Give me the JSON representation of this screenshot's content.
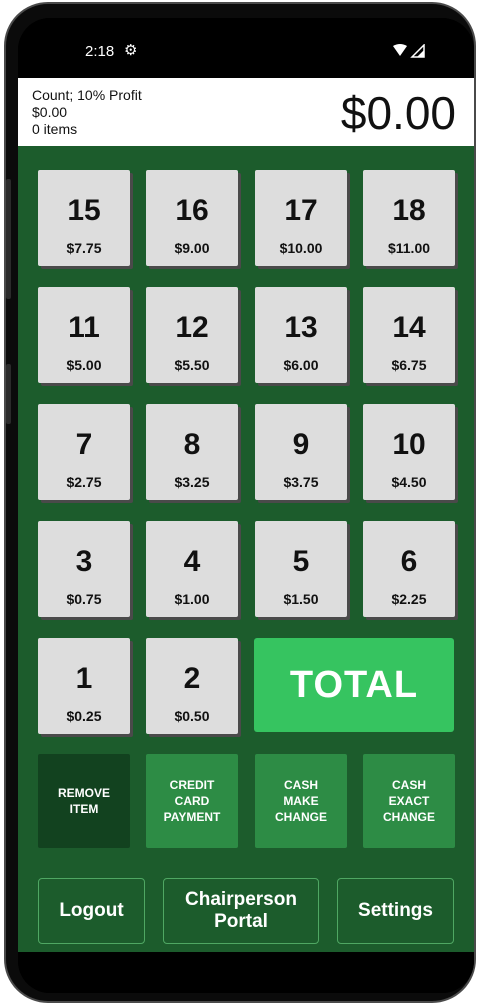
{
  "status_bar": {
    "time": "2:18",
    "settings_glyph": "gear-icon",
    "wifi_icon": "wifi-icon",
    "signal_icon": "signal-icon"
  },
  "header": {
    "line1": "Count; 10% Profit",
    "line2": "$0.00",
    "line3": "0 items",
    "total": "$0.00"
  },
  "tiles": [
    {
      "num": "15",
      "price": "$7.75"
    },
    {
      "num": "16",
      "price": "$9.00"
    },
    {
      "num": "17",
      "price": "$10.00"
    },
    {
      "num": "18",
      "price": "$11.00"
    },
    {
      "num": "11",
      "price": "$5.00"
    },
    {
      "num": "12",
      "price": "$5.50"
    },
    {
      "num": "13",
      "price": "$6.00"
    },
    {
      "num": "14",
      "price": "$6.75"
    },
    {
      "num": "7",
      "price": "$2.75"
    },
    {
      "num": "8",
      "price": "$3.25"
    },
    {
      "num": "9",
      "price": "$3.75"
    },
    {
      "num": "10",
      "price": "$4.50"
    },
    {
      "num": "3",
      "price": "$0.75"
    },
    {
      "num": "4",
      "price": "$1.00"
    },
    {
      "num": "5",
      "price": "$1.50"
    },
    {
      "num": "6",
      "price": "$2.25"
    },
    {
      "num": "1",
      "price": "$0.25"
    },
    {
      "num": "2",
      "price": "$0.50"
    }
  ],
  "total_button": "TOTAL",
  "actions": {
    "remove": [
      "REMOVE",
      "ITEM"
    ],
    "credit": [
      "CREDIT",
      "CARD",
      "PAYMENT"
    ],
    "make_change": [
      "CASH",
      "MAKE",
      "CHANGE"
    ],
    "exact_change": [
      "CASH",
      "EXACT",
      "CHANGE"
    ]
  },
  "bottom": {
    "logout": "Logout",
    "chair": [
      "Chairperson",
      "Portal"
    ],
    "settings": "Settings"
  },
  "colors": {
    "background_green": "#1c5c2c",
    "tile_gray": "#dddddd",
    "total_green": "#36c460",
    "action_green": "#2d8c45",
    "remove_dark_green": "#12421f"
  }
}
